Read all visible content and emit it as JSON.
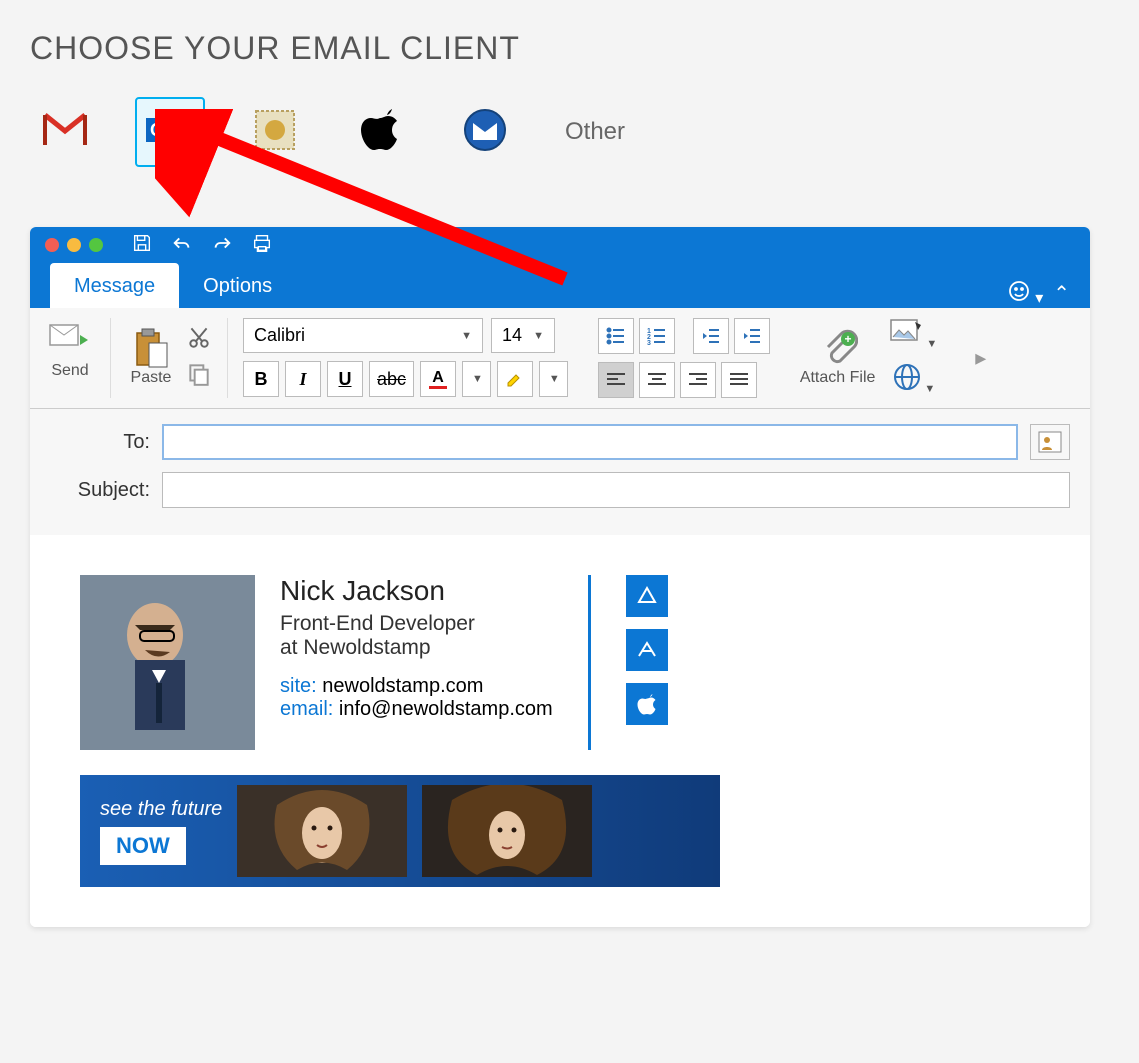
{
  "heading": "CHOOSE YOUR EMAIL CLIENT",
  "clients": {
    "other_label": "Other"
  },
  "outlook": {
    "tabs": {
      "message": "Message",
      "options": "Options"
    },
    "send_label": "Send",
    "paste_label": "Paste",
    "font_name": "Calibri",
    "font_size": "14",
    "attach_label": "Attach File",
    "fields": {
      "to_label": "To:",
      "subject_label": "Subject:",
      "to_value": "",
      "subject_value": ""
    },
    "format": {
      "bold": "B",
      "italic": "I",
      "underline": "U",
      "strike": "abc",
      "fontcolor": "A"
    }
  },
  "signature": {
    "name": "Nick Jackson",
    "title": "Front-End Developer",
    "company_line": "at Newoldstamp",
    "site_label": "site:",
    "site_value": "newoldstamp.com",
    "email_label": "email:",
    "email_value": "info@newoldstamp.com"
  },
  "banner": {
    "line1": "see the future",
    "button": "NOW"
  }
}
